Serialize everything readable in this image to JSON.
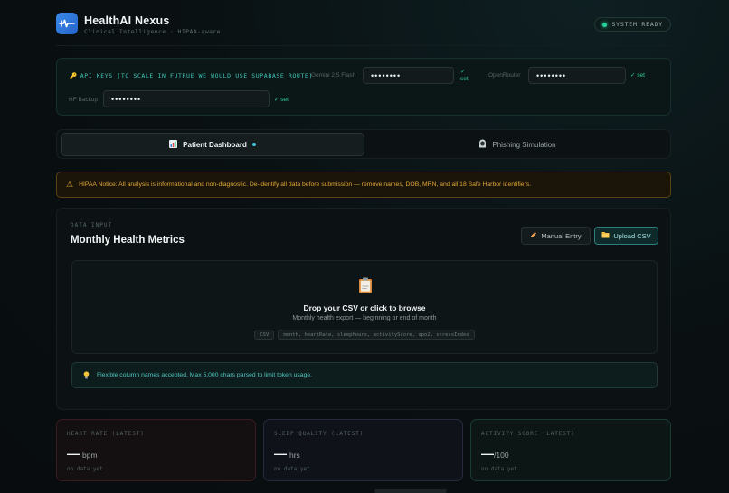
{
  "header": {
    "title": "HealthAI Nexus",
    "subtitle": "Clinical Intelligence · HIPAA-aware",
    "status": "SYSTEM READY"
  },
  "api_keys": {
    "title": "API KEYS (TO SCALE IN FUTRUE WE WOULD USE SUPABASE ROUTE)",
    "gemini_label": "Gemini 2.5 Flash",
    "gemini_value": "••••••••",
    "openrouter_label": "OpenRouter",
    "openrouter_value": "••••••••",
    "hf_label": "HF Backup",
    "hf_value": "••••••••",
    "set_label": "✓ set"
  },
  "tabs": [
    {
      "label": "Patient Dashboard"
    },
    {
      "label": "Phishing Simulation"
    }
  ],
  "notice": {
    "text": "HIPAA Notice: All analysis is informational and non-diagnostic. De-identify all data before submission — remove names, DOB, MRN, and all 18 Safe Harbor identifiers."
  },
  "data_input": {
    "kicker": "DATA INPUT",
    "title": "Monthly Health Metrics",
    "manual_button": "Manual Entry",
    "upload_button": "Upload CSV",
    "drop_title": "Drop your CSV or click to browse",
    "drop_subtitle": "Monthly health export — beginning or end of month",
    "chip_format": "CSV",
    "chip_columns": "month, heartRate, sleepHours, activityScore, spo2, stressIndex",
    "hint": "Flexible column names accepted. Max 5,000 chars parsed to limit token usage."
  },
  "metrics": [
    {
      "label": "HEART RATE (LATEST)",
      "value": "—",
      "unit": "bpm",
      "foot": "no data yet"
    },
    {
      "label": "SLEEP QUALITY (LATEST)",
      "value": "—",
      "unit": "hrs",
      "foot": "no data yet"
    },
    {
      "label": "ACTIVITY SCORE (LATEST)",
      "value": "—",
      "unit": "/100",
      "foot": "no data yet"
    }
  ],
  "colors": {
    "accent": "#3fc7b7",
    "success": "#2fcf95",
    "warning": "#e2a838",
    "logo": "#3a8be8"
  }
}
